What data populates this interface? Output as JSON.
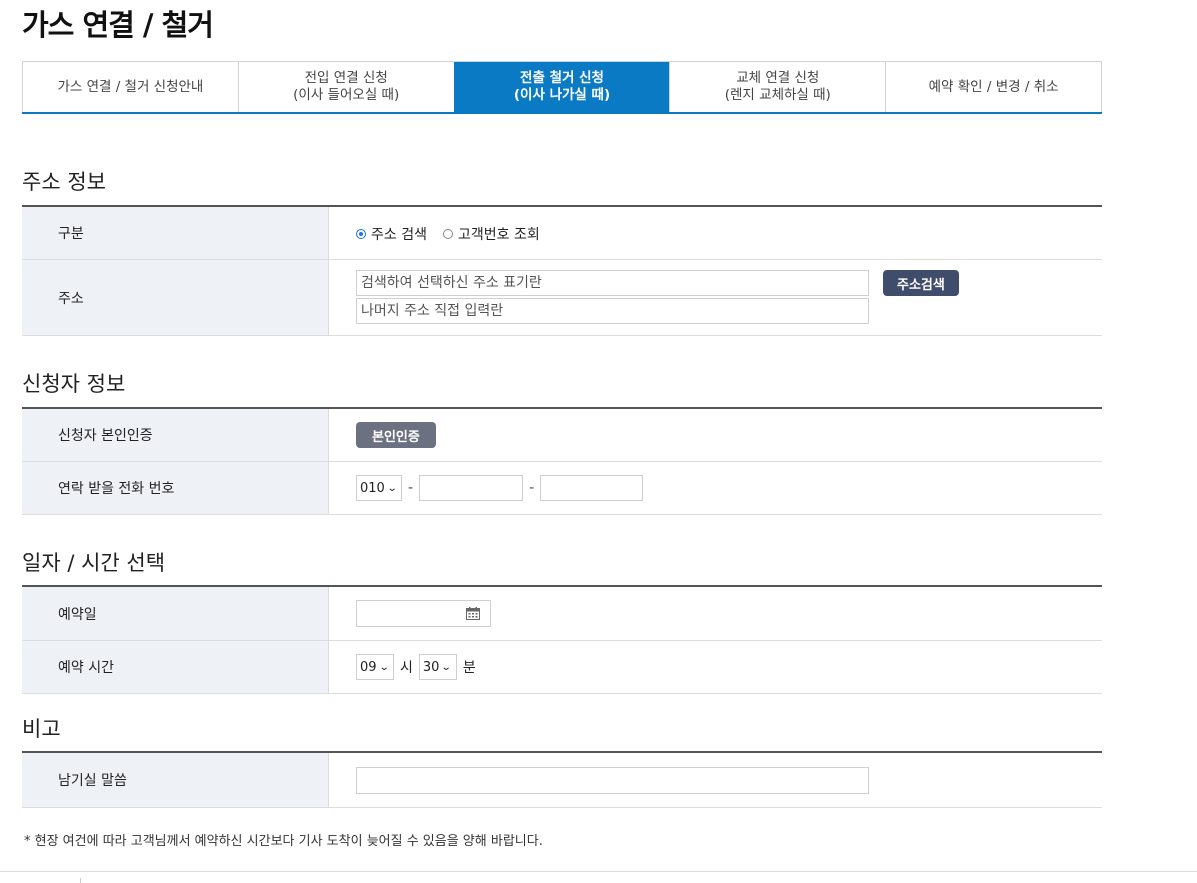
{
  "page": {
    "title": "가스 연결 / 철거"
  },
  "tabs": [
    {
      "line1": "가스 연결 / 철거 신청안내",
      "line2": ""
    },
    {
      "line1": "전입 연결 신청",
      "line2": "(이사 들어오실 때)"
    },
    {
      "line1": "전출 철거 신청",
      "line2": "(이사 나가실 때)"
    },
    {
      "line1": "교체 연결 신청",
      "line2": "(렌지 교체하실 때)"
    },
    {
      "line1": "예약 확인 / 변경 / 취소",
      "line2": ""
    }
  ],
  "active_tab": 2,
  "address": {
    "title": "주소 정보",
    "type_label": "구분",
    "radio_address": "주소 검색",
    "radio_customer": "고객번호 조회",
    "address_label": "주소",
    "address_placeholder": "검색하여 선택하신 주소 표기란",
    "detail_placeholder": "나머지 주소 직접 입력란",
    "search_button": "주소검색"
  },
  "applicant": {
    "title": "신청자 정보",
    "auth_label": "신청자 본인인증",
    "auth_button": "본인인증",
    "phone_label": "연락 받을 전화 번호",
    "phone_prefix": "010",
    "dash": "-"
  },
  "datetime": {
    "title": "일자 / 시간 선택",
    "date_label": "예약일",
    "time_label": "예약 시간",
    "hour": "09",
    "hour_unit": "시",
    "minute": "30",
    "minute_unit": "분"
  },
  "remarks": {
    "title": "비고",
    "message_label": "남기실 말씀"
  },
  "footnote": "* 현장 여건에 따라 고객님께서 예약하신 시간보다 기사 도착이 늦어질 수 있음을 양해 바랍니다.",
  "colors": {
    "accent": "#0a7ac4",
    "label_bg": "#eef2f7",
    "search_button": "#3f4c6b",
    "auth_button": "#6b7180"
  }
}
